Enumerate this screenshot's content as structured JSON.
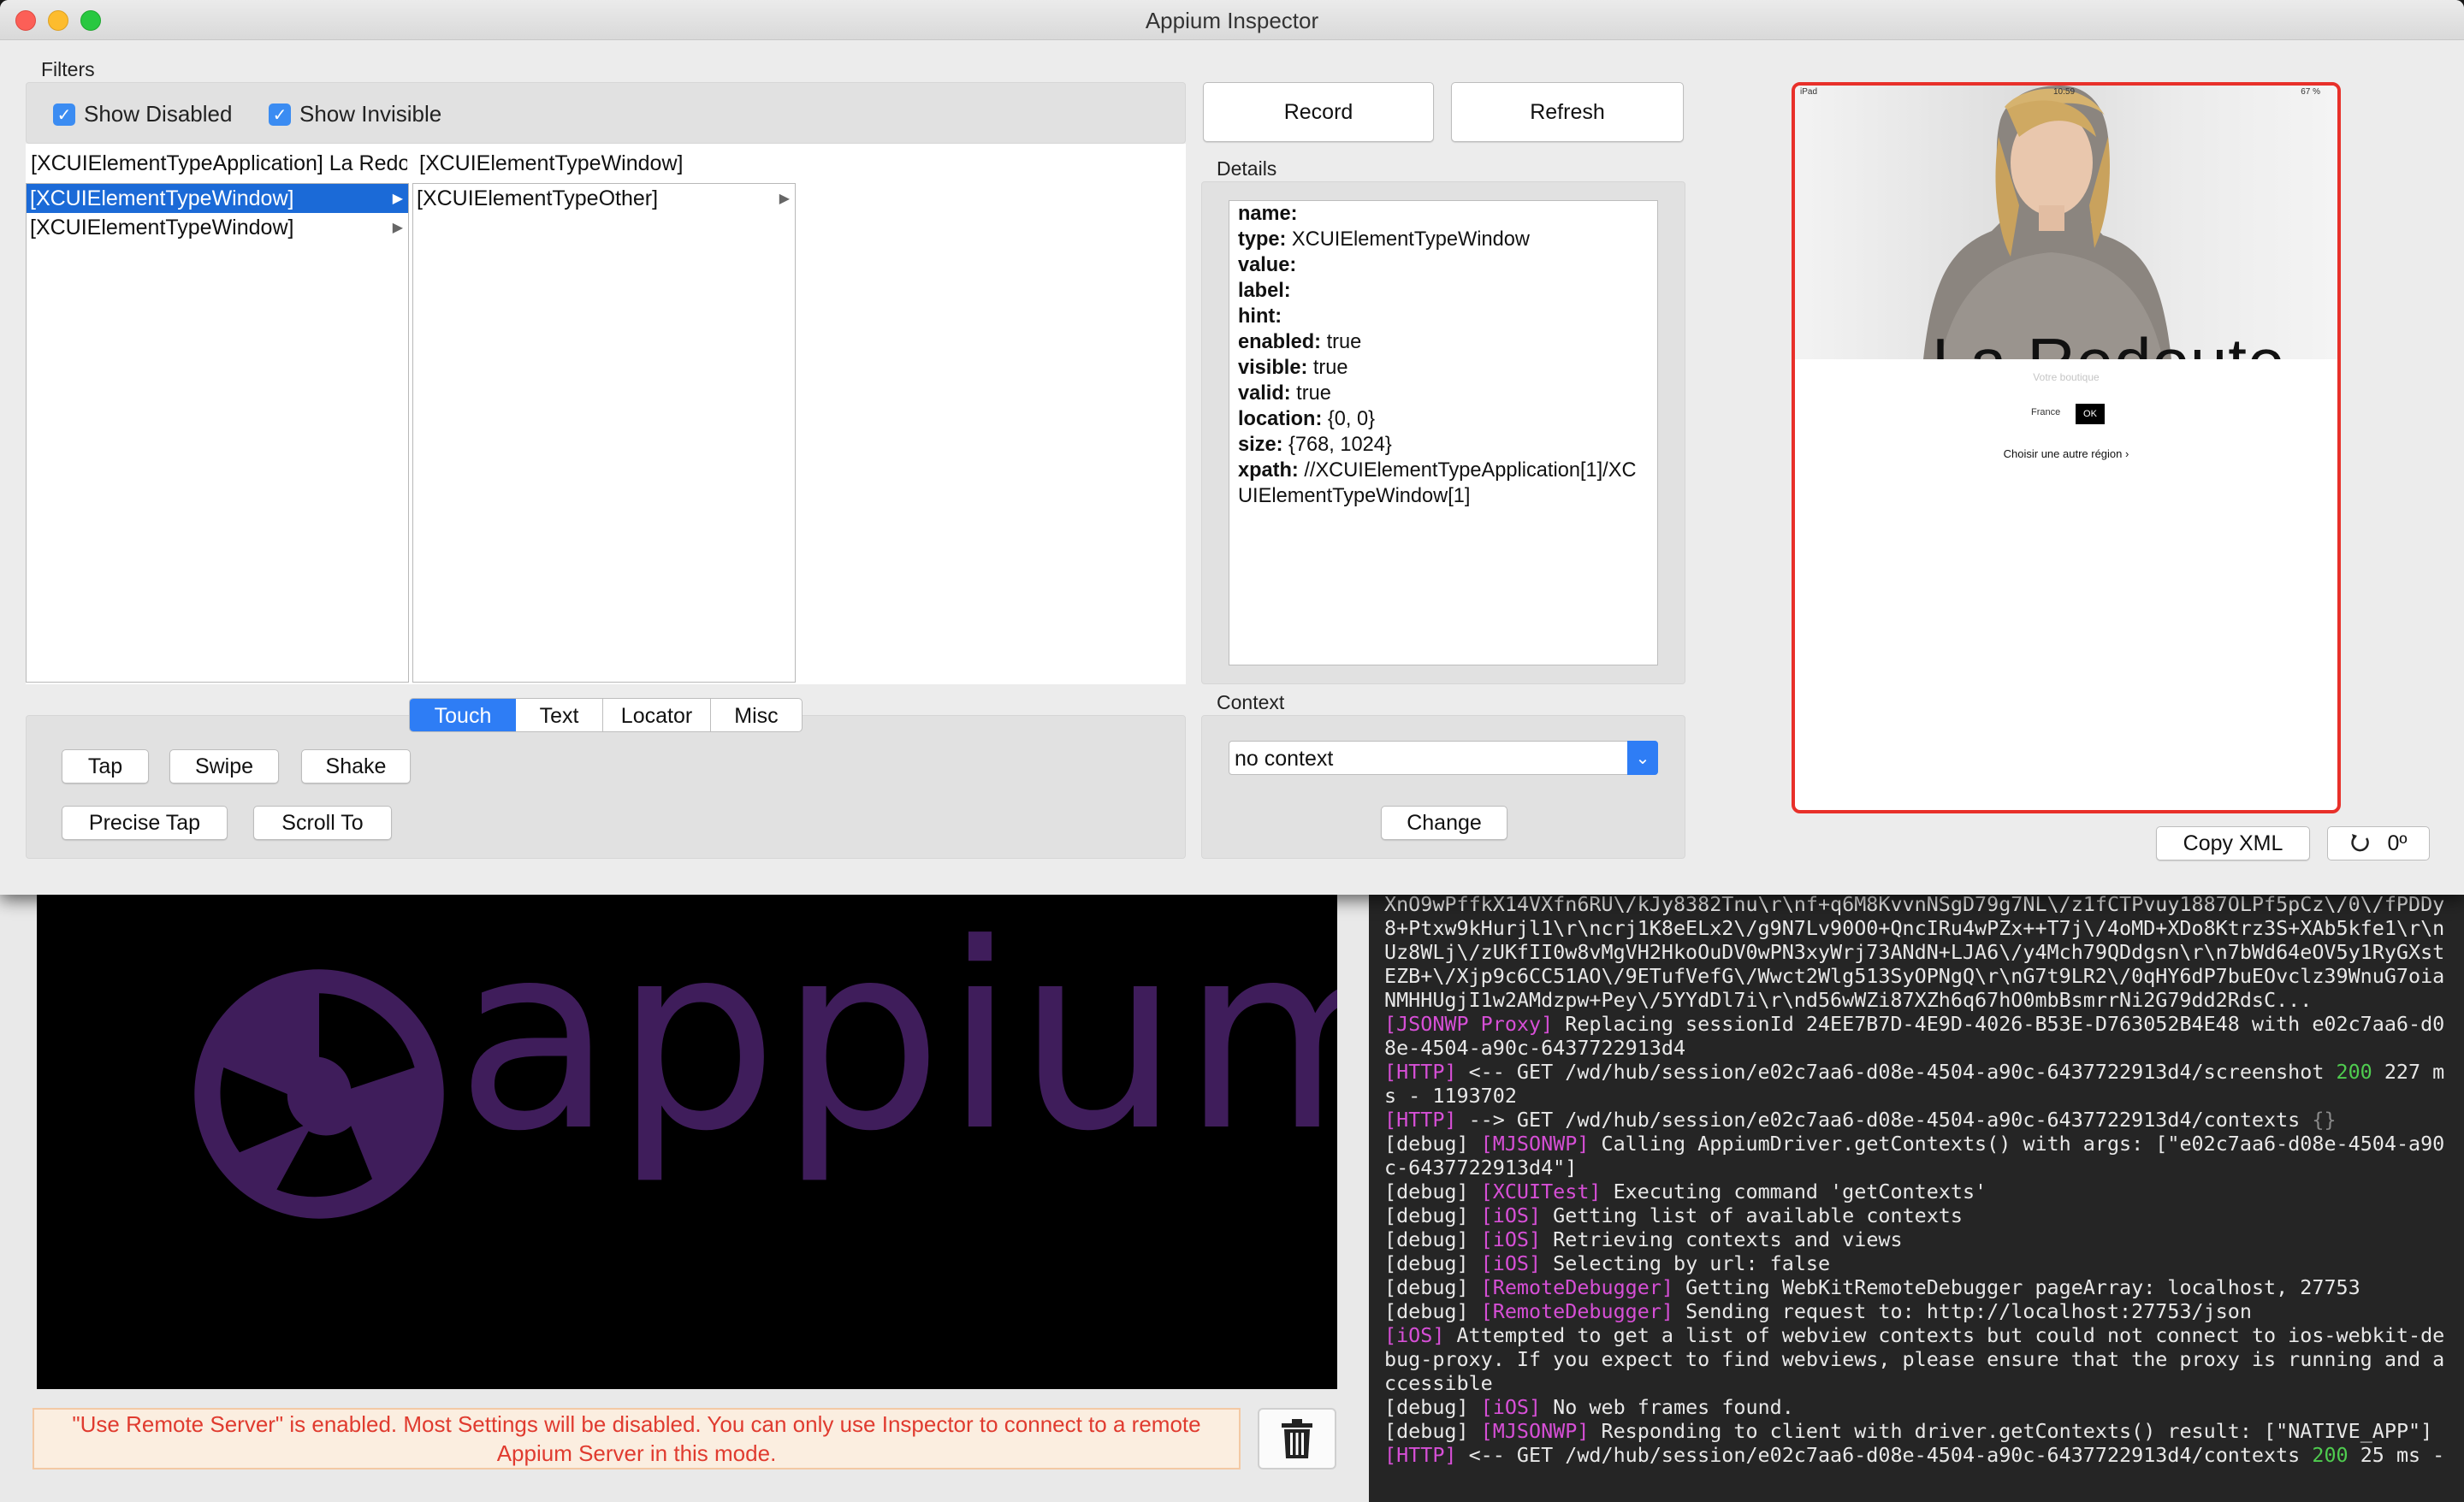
{
  "window": {
    "title": "Appium Inspector"
  },
  "filters": {
    "label": "Filters",
    "show_disabled": {
      "label": "Show Disabled",
      "checked": true
    },
    "show_invisible": {
      "label": "Show Invisible",
      "checked": true
    }
  },
  "tree": {
    "col1_header": "[XCUIElementTypeApplication] La Redoute",
    "col2_header": "[XCUIElementTypeWindow]",
    "col1_items": [
      {
        "label": "[XCUIElementTypeWindow]",
        "selected": true,
        "has_children": true
      },
      {
        "label": "[XCUIElementTypeWindow]",
        "selected": false,
        "has_children": true
      }
    ],
    "col2_items": [
      {
        "label": "[XCUIElementTypeOther]",
        "selected": false,
        "has_children": true
      }
    ]
  },
  "action_tabs": [
    "Touch",
    "Text",
    "Locator",
    "Misc"
  ],
  "active_tab": "Touch",
  "touch_actions": {
    "tap": "Tap",
    "swipe": "Swipe",
    "shake": "Shake",
    "precise_tap": "Precise Tap",
    "scroll_to": "Scroll To"
  },
  "toolbar": {
    "record": "Record",
    "refresh": "Refresh"
  },
  "details": {
    "label": "Details",
    "fields": [
      {
        "key": "name:",
        "value": ""
      },
      {
        "key": "type:",
        "value": "XCUIElementTypeWindow"
      },
      {
        "key": "value:",
        "value": ""
      },
      {
        "key": "label:",
        "value": ""
      },
      {
        "key": "hint:",
        "value": ""
      },
      {
        "key": "enabled:",
        "value": "true"
      },
      {
        "key": "visible:",
        "value": "true"
      },
      {
        "key": "valid:",
        "value": "true"
      },
      {
        "key": "location:",
        "value": "{0, 0}"
      },
      {
        "key": "size:",
        "value": "{768, 1024}"
      },
      {
        "key": "xpath:",
        "value": "//XCUIElementTypeApplication[1]/XCUIElementTypeWindow[1]"
      }
    ]
  },
  "context": {
    "label": "Context",
    "selected": "no context",
    "change": "Change"
  },
  "device_screen": {
    "status_left": "iPad",
    "status_center": "10:59",
    "status_right": "67 %",
    "brand": "La Redoute",
    "shop_label": "Votre boutique",
    "country": "France",
    "ok": "OK",
    "region_link": "Choisir une autre région ›"
  },
  "copy_xml": "Copy XML",
  "rotation": "0º",
  "server": {
    "logo_text": "appium",
    "warning": "\"Use Remote Server\" is enabled. Most Settings will be disabled. You can only use Inspector to connect to a remote Appium Server in this mode."
  },
  "log_lines": [
    {
      "tag": "",
      "tag_style": "",
      "text": "XnO9wPffkX14VXfn6RU\\/kJy8382Tnu\\r\\nf+q6M8KvvnNSgD79g7NL\\/z1fCTPvuy1887OLPf5pCz\\/0\\/fPDDy8+Ptxw9kHurjl1\\r\\ncrj1K8eELx2\\/g9N7Lv90O0+QncIRu4wPZx++T7j\\/4oMD+XDo8Ktrz3S+XAb5kfe1\\r\\nUz8WLj\\/zUKfII0w8vMgVH2HkoOuDV0wPN3xyWrj73ANdN+LJA6\\/y4Mch79QDdgsn\\r\\n7bWd64eOV5y1RyGXstEZB+\\/Xjp9c6CC51AO\\/9ETufVefG\\/Wwct2Wlg513SyOPNgQ\\r\\nG7t9LR2\\/0qHY6dP7buEOvclz39WnuG7oiaNMHHUgjI1w2AMdzpw+Pey\\/5YYdDl7i\\r\\nd56wWZi87XZh6q67hO0mbBsmrrNi2G79dd2RdsC...",
      "suffix": "",
      "suffix_style": ""
    },
    {
      "tag": "[JSONWP Proxy]",
      "tag_style": "mag",
      "text": " Replacing sessionId 24EE7B7D-4E9D-4026-B53E-D763052B4E48 with e02c7aa6-d08e-4504-a90c-6437722913d4",
      "suffix": "",
      "suffix_style": ""
    },
    {
      "tag": "[HTTP]",
      "tag_style": "mag",
      "text": " <-- GET /wd/hub/session/e02c7aa6-d08e-4504-a90c-6437722913d4/screenshot ",
      "suffix": "200",
      "suffix_style": "grn",
      "tail": " 227 ms - 1193702"
    },
    {
      "tag": "[HTTP]",
      "tag_style": "mag",
      "text": " --> GET /wd/hub/session/e02c7aa6-d08e-4504-a90c-6437722913d4/contexts ",
      "suffix": "{}",
      "suffix_style": "gry"
    },
    {
      "prefix": "[debug] ",
      "tag": "[MJSONWP]",
      "tag_style": "mag",
      "text": " Calling AppiumDriver.getContexts() with args: [\"e02c7aa6-d08e-4504-a90c-6437722913d4\"]"
    },
    {
      "prefix": "[debug] ",
      "tag": "[XCUITest]",
      "tag_style": "mag",
      "text": " Executing command 'getContexts'"
    },
    {
      "prefix": "[debug] ",
      "tag": "[iOS]",
      "tag_style": "mag",
      "text": " Getting list of available contexts"
    },
    {
      "prefix": "[debug] ",
      "tag": "[iOS]",
      "tag_style": "mag",
      "text": " Retrieving contexts and views"
    },
    {
      "prefix": "[debug] ",
      "tag": "[iOS]",
      "tag_style": "mag",
      "text": " Selecting by url: false"
    },
    {
      "prefix": "[debug] ",
      "tag": "[RemoteDebugger]",
      "tag_style": "mag",
      "text": " Getting WebKitRemoteDebugger pageArray: localhost, 27753"
    },
    {
      "prefix": "[debug] ",
      "tag": "[RemoteDebugger]",
      "tag_style": "mag",
      "text": " Sending request to: http://localhost:27753/json"
    },
    {
      "tag": "[iOS]",
      "tag_style": "mag",
      "text": " Attempted to get a list of webview contexts but could not connect to ios-webkit-debug-proxy. If you expect to find webviews, please ensure that the proxy is running and accessible"
    },
    {
      "prefix": "[debug] ",
      "tag": "[iOS]",
      "tag_style": "mag",
      "text": " No web frames found."
    },
    {
      "prefix": "[debug] ",
      "tag": "[MJSONWP]",
      "tag_style": "mag",
      "text": " Responding to client with driver.getContexts() result: [\"NATIVE_APP\"]"
    },
    {
      "tag": "[HTTP]",
      "tag_style": "mag",
      "text": " <-- GET /wd/hub/session/e02c7aa6-d08e-4504-a90c-6437722913d4/contexts ",
      "suffix": "200",
      "suffix_style": "grn",
      "tail": " 25 ms -"
    }
  ]
}
